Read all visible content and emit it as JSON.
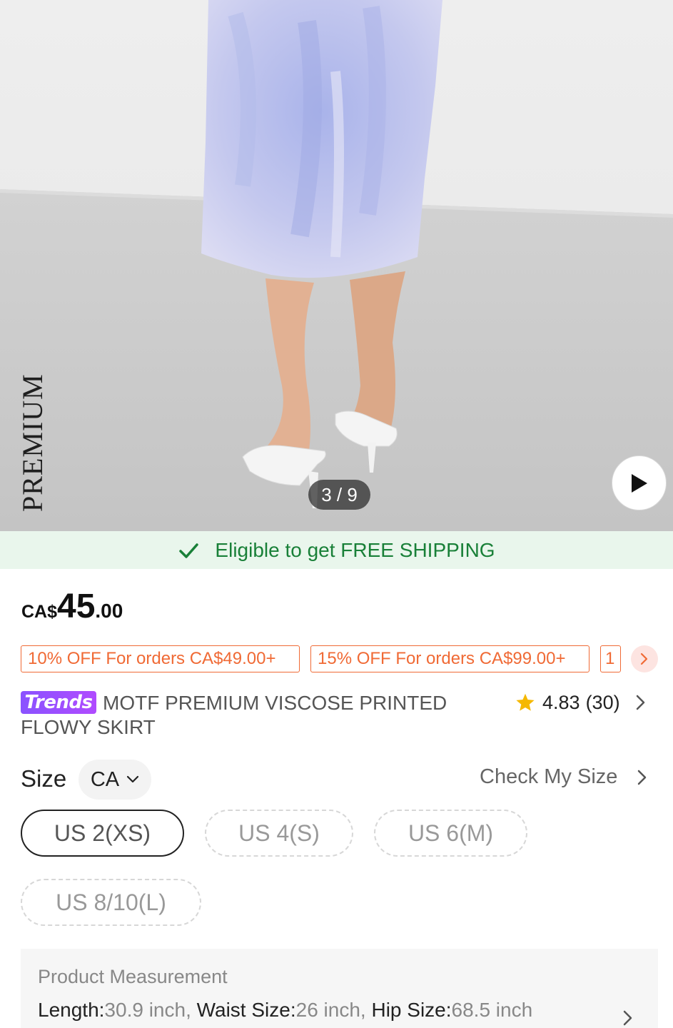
{
  "image": {
    "brand_mark": "PREMIUM",
    "counter": "3 / 9"
  },
  "shipping": {
    "text": "Eligible to get FREE SHIPPING",
    "color": "#198038",
    "bg": "#e9f6ec"
  },
  "price": {
    "currency": "CA$",
    "integer": "45",
    "decimal": ".00"
  },
  "coupons": [
    {
      "label": "10% OFF For orders CA$49.00+"
    },
    {
      "label": "15% OFF For orders CA$99.00+"
    },
    {
      "label": "1"
    }
  ],
  "product": {
    "badge": "Trends",
    "title": "MOTF PREMIUM VISCOSE PRINTED FLOWY SKIRT",
    "rating": "4.83",
    "review_count": "(30)"
  },
  "size": {
    "label": "Size",
    "region": "CA",
    "check_my_size": "Check My Size",
    "options": [
      {
        "label": "US 2(XS)",
        "selected": true
      },
      {
        "label": "US 4(S)",
        "selected": false
      },
      {
        "label": "US 6(M)",
        "selected": false
      },
      {
        "label": "US 8/10(L)",
        "selected": false
      }
    ]
  },
  "measurement": {
    "title": "Product Measurement",
    "length_label": "Length:",
    "length_value": "30.9 inch,",
    "waist_label": "Waist Size:",
    "waist_value": "26 inch,",
    "hip_label": "Hip Size:",
    "hip_value": "68.5 inch"
  },
  "colors": {
    "accent_orange": "#f06a35",
    "trends_purple": "#8a52ff",
    "star": "#f5b800"
  }
}
